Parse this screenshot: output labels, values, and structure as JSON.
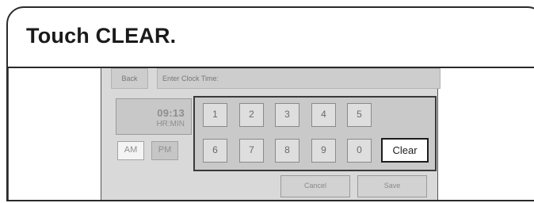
{
  "instruction": {
    "text": "Touch CLEAR."
  },
  "screen": {
    "back_label": "Back",
    "header_label": "Enter Clock Time:",
    "time": {
      "value": "09:13",
      "unit": "HR:MIN"
    },
    "ampm": {
      "am": "AM",
      "pm": "PM"
    },
    "keypad": {
      "row1": [
        "1",
        "2",
        "3",
        "4",
        "5"
      ],
      "row2": [
        "6",
        "7",
        "8",
        "9",
        "0"
      ],
      "clear_label": "Clear"
    },
    "cancel_label": "Cancel",
    "save_label": "Save"
  }
}
